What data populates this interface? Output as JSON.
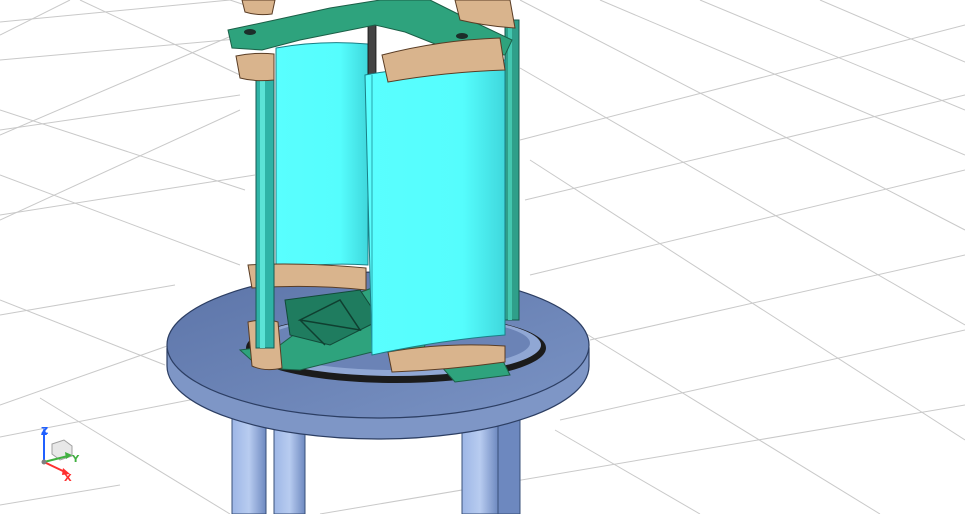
{
  "viewport": {
    "background": "#ffffff",
    "grid_color": "#c8c8c8"
  },
  "model": {
    "blade_color": "#55ffff",
    "frame_color": "#2ea37d",
    "bracket_color": "#d9b48d",
    "platform_color": "#6b84b4",
    "leg_color": "#8fa9db"
  },
  "view_triad": {
    "icon": "axis-triad-icon",
    "z_label": "Z",
    "y_label": "Y",
    "x_label": "X",
    "z_color": "#2060ff",
    "y_color": "#40b040",
    "x_color": "#ff3030"
  }
}
